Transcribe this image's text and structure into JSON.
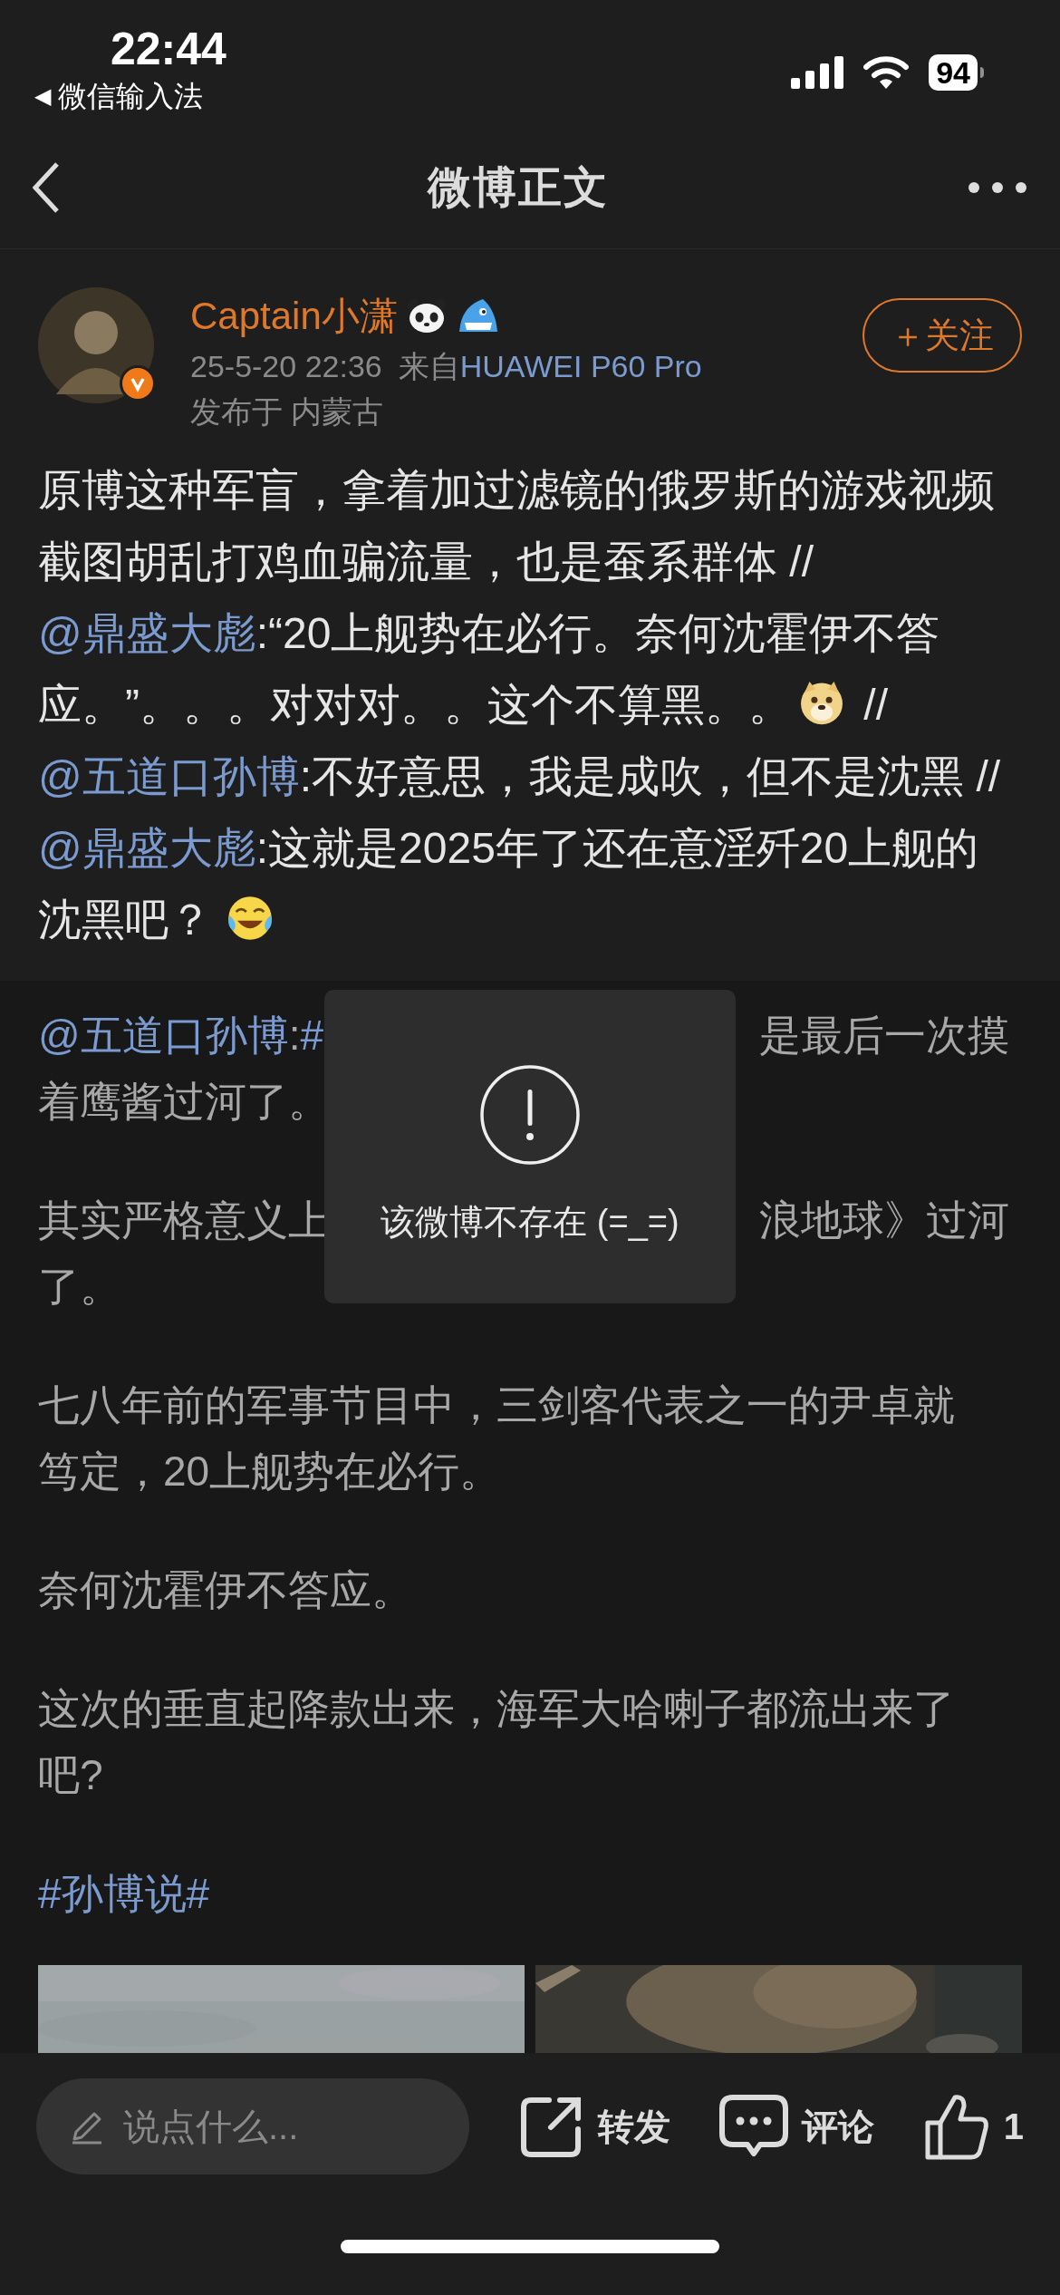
{
  "status_bar": {
    "time": "22:44",
    "back_arrow": "◀",
    "back_app": "微信输入法",
    "battery": "94"
  },
  "nav": {
    "title": "微博正文"
  },
  "post": {
    "author": "Captain小潇",
    "time": "25-5-20 22:36",
    "source_prefix": "来自",
    "source": "HUAWEI P60 Pro",
    "location": "发布于 内蒙古",
    "follow": "＋关注",
    "segments": [
      {
        "kind": "plain",
        "text": "原博这种军盲，拿着加过滤镜的俄罗斯的游戏视频截图胡乱打鸡血骗流量，也是蚕系群体 //"
      },
      {
        "kind": "mention",
        "text": "@鼎盛大彪"
      },
      {
        "kind": "plain",
        "text": ":“20上舰势在必行。奈何沈霍伊不答应。”。。。对对对。。这个不算黑。。"
      },
      {
        "kind": "doge_sticker"
      },
      {
        "kind": "plain",
        "text": " //"
      },
      {
        "kind": "mention",
        "text": "@五道口孙博"
      },
      {
        "kind": "plain",
        "text": ":不好意思，我是成吹，但不是沈黑 //"
      },
      {
        "kind": "mention",
        "text": "@鼎盛大彪"
      },
      {
        "kind": "plain",
        "text": ":这就是2025年了还在意淫歼20上舰的沈黑吧？"
      },
      {
        "kind": "laugh_sticker"
      }
    ]
  },
  "repost": {
    "paragraphs": [
      {
        "lines": [
          {
            "segments": [
              {
                "kind": "mention",
                "text": "@五道口孙博"
              },
              {
                "kind": "plain",
                "text": ":"
              },
              {
                "kind": "topic",
                "text": "#"
              }
            ],
            "right": "是最后一次摸"
          },
          {
            "segments": [
              {
                "kind": "plain",
                "text": "着鹰酱过河了。"
              }
            ]
          }
        ]
      },
      {
        "lines": [
          {
            "segments": [
              {
                "kind": "plain",
                "text": "其实严格意义上"
              }
            ],
            "right": "浪地球》过河"
          },
          {
            "segments": [
              {
                "kind": "plain",
                "text": "了。"
              }
            ]
          }
        ]
      },
      {
        "lines": [
          {
            "segments": [
              {
                "kind": "plain",
                "text": "七八年前的军事节目中，三剑客代表之一的尹卓就"
              }
            ]
          },
          {
            "segments": [
              {
                "kind": "plain",
                "text": "笃定，20上舰势在必行。"
              }
            ]
          }
        ]
      },
      {
        "lines": [
          {
            "segments": [
              {
                "kind": "plain",
                "text": "奈何沈霍伊不答应。"
              }
            ]
          }
        ]
      },
      {
        "lines": [
          {
            "segments": [
              {
                "kind": "plain",
                "text": "这次的垂直起降款出来，海军大哈喇子都流出来了"
              }
            ]
          },
          {
            "segments": [
              {
                "kind": "plain",
                "text": "吧?"
              }
            ]
          }
        ]
      },
      {
        "lines": [
          {
            "segments": [
              {
                "kind": "topic",
                "text": "#孙博说#"
              }
            ]
          }
        ]
      }
    ]
  },
  "toast": {
    "message": "该微博不存在 (=_=)"
  },
  "bottom_bar": {
    "placeholder": "说点什么...",
    "repost": "转发",
    "comment": "评论",
    "likes": "1"
  }
}
